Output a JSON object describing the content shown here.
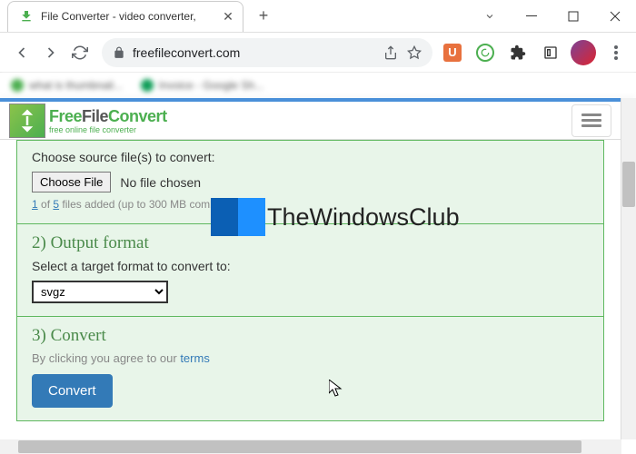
{
  "browser": {
    "tab_title": "File Converter - video converter,",
    "url": "freefileconvert.com",
    "bookmarks": [
      "what is thumbnail...",
      "Invoice - Google Sh..."
    ]
  },
  "site": {
    "logo_text_parts": {
      "free": "Free",
      "file": "File",
      "convert": "Convert"
    },
    "logo_subtitle": "free online file converter"
  },
  "step1": {
    "label": "Choose source file(s) to convert:",
    "choose_btn": "Choose File",
    "no_file": "No file chosen",
    "files_current": "1",
    "files_of": "of",
    "files_max": "5",
    "files_suffix": "files added (up to 300 MB combined)"
  },
  "step2": {
    "title": "2) Output format",
    "label": "Select a target format to convert to:",
    "selected": "svgz"
  },
  "step3": {
    "title": "3) Convert",
    "agree_text": "By clicking you agree to our ",
    "terms_link": "terms",
    "convert_btn": "Convert"
  },
  "watermark": "TheWindowsClub"
}
